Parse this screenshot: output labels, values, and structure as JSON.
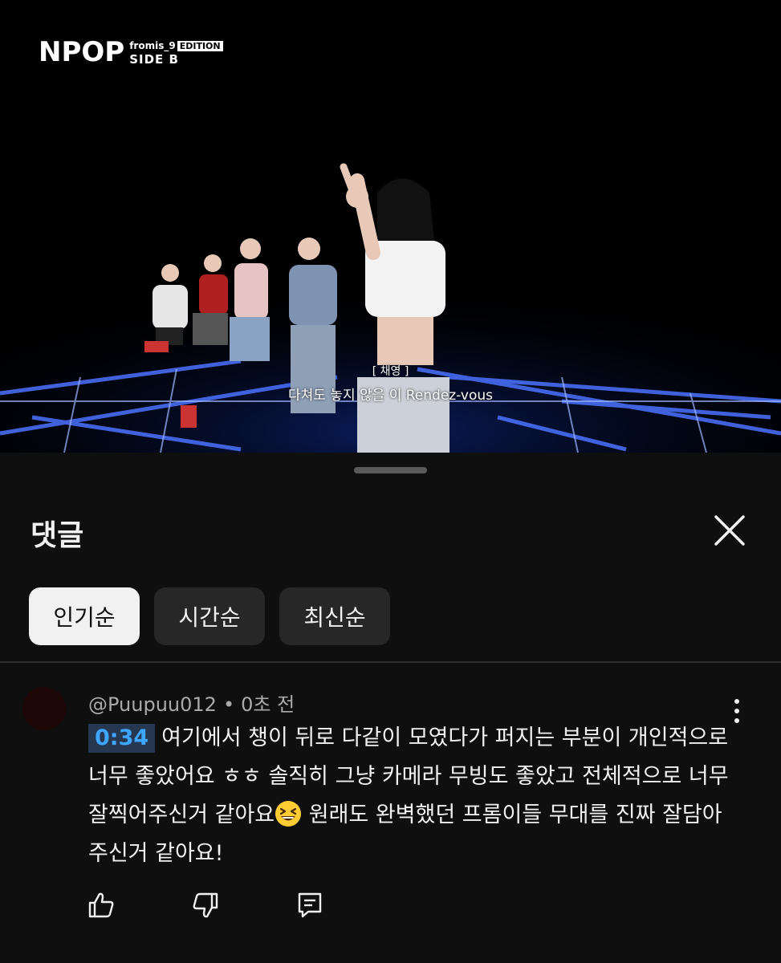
{
  "video": {
    "logo_main": "NPOP",
    "logo_sub": "fromis_9",
    "logo_edition": "EDITION",
    "logo_side": "SIDE B",
    "subtitle_speaker": "[ 채영 ]",
    "subtitle_line": "다쳐도 놓지 않을 이 Rendez-vous"
  },
  "panel": {
    "title": "댓글",
    "chips": [
      {
        "label": "인기순",
        "active": true
      },
      {
        "label": "시간순",
        "active": false
      },
      {
        "label": "최신순",
        "active": false
      }
    ]
  },
  "comment": {
    "author": "@Puupuu012",
    "time": "0초 전",
    "timestamp": "0:34",
    "text_1": "여기에서 챙이 뒤로 다같이 모였다가 퍼지는 부분이 개인적으로 너무 좋았어요 ㅎㅎ 솔직히 그냥 카메라 무빙도 좋았고 전체적으로 너무 잘찍어주신거 같아요",
    "text_2": " 원래도 완벽했던 프롬이들 무대를 진짜 잘담아주신거 같아요!"
  },
  "icons": {
    "close": "close-icon",
    "more": "more-vert-icon",
    "like": "thumbs-up-icon",
    "dislike": "thumbs-down-icon",
    "reply": "reply-icon",
    "emoji": "grinning-squinting-face-emoji"
  },
  "colors": {
    "background": "#0f0f0f",
    "chip": "#272727",
    "chip_active": "#f1f1f1",
    "timestamp_text": "#3ea6ff",
    "timestamp_bg": "#263850"
  }
}
